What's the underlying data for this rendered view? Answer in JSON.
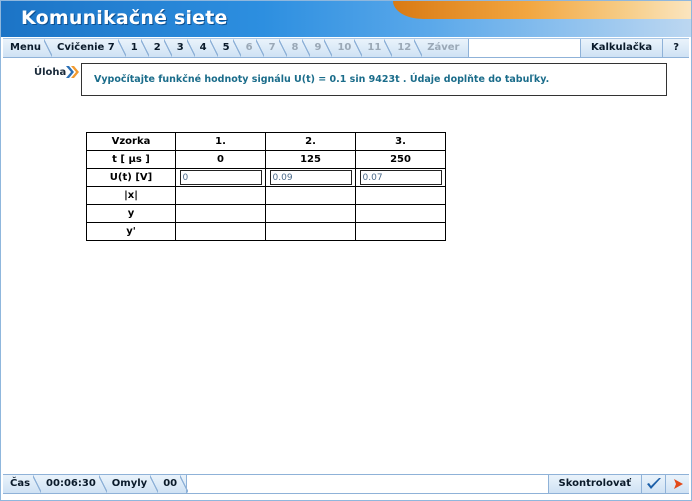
{
  "app": {
    "title": "Komunikačné siete"
  },
  "nav": {
    "left_tabs": [
      {
        "label": "Menu",
        "enabled": true
      },
      {
        "label": "Cvičenie 7",
        "enabled": true
      },
      {
        "label": "1",
        "enabled": true
      },
      {
        "label": "2",
        "enabled": true
      },
      {
        "label": "3",
        "enabled": true
      },
      {
        "label": "4",
        "enabled": true
      },
      {
        "label": "5",
        "enabled": true
      },
      {
        "label": "6",
        "enabled": false
      },
      {
        "label": "7",
        "enabled": false
      },
      {
        "label": "8",
        "enabled": false
      },
      {
        "label": "9",
        "enabled": false
      },
      {
        "label": "10",
        "enabled": false
      },
      {
        "label": "11",
        "enabled": false
      },
      {
        "label": "12",
        "enabled": false
      },
      {
        "label": "Záver",
        "enabled": false
      }
    ],
    "calculator": "Kalkulačka",
    "help": "?"
  },
  "task": {
    "label": "Úloha",
    "text": "Vypočítajte funkčné hodnoty signálu U(t) = 0.1 sin 9423t . Údaje doplňte do tabuľky."
  },
  "table": {
    "header": [
      "Vzorka",
      "1.",
      "2.",
      "3."
    ],
    "time_row": {
      "label": "t [ µs ]",
      "values": [
        "0",
        "125",
        "250"
      ]
    },
    "u_row": {
      "label": "U(t) [V]",
      "inputs": [
        "0",
        "0.09",
        "0.07"
      ]
    },
    "empty_rows": [
      "|x|",
      "y",
      "y'"
    ]
  },
  "status": {
    "time_label": "Čas",
    "time_value": "00:06:30",
    "errors_label": "Omyly",
    "errors_value": "00",
    "check_label": "Skontrolovať"
  },
  "colors": {
    "title_blue": "#1c74c6",
    "title_orange": "#d97a14",
    "task_text": "#1a6c8a",
    "check_icon": "#1c5fa8",
    "next_arrow": "#e24a1a"
  }
}
